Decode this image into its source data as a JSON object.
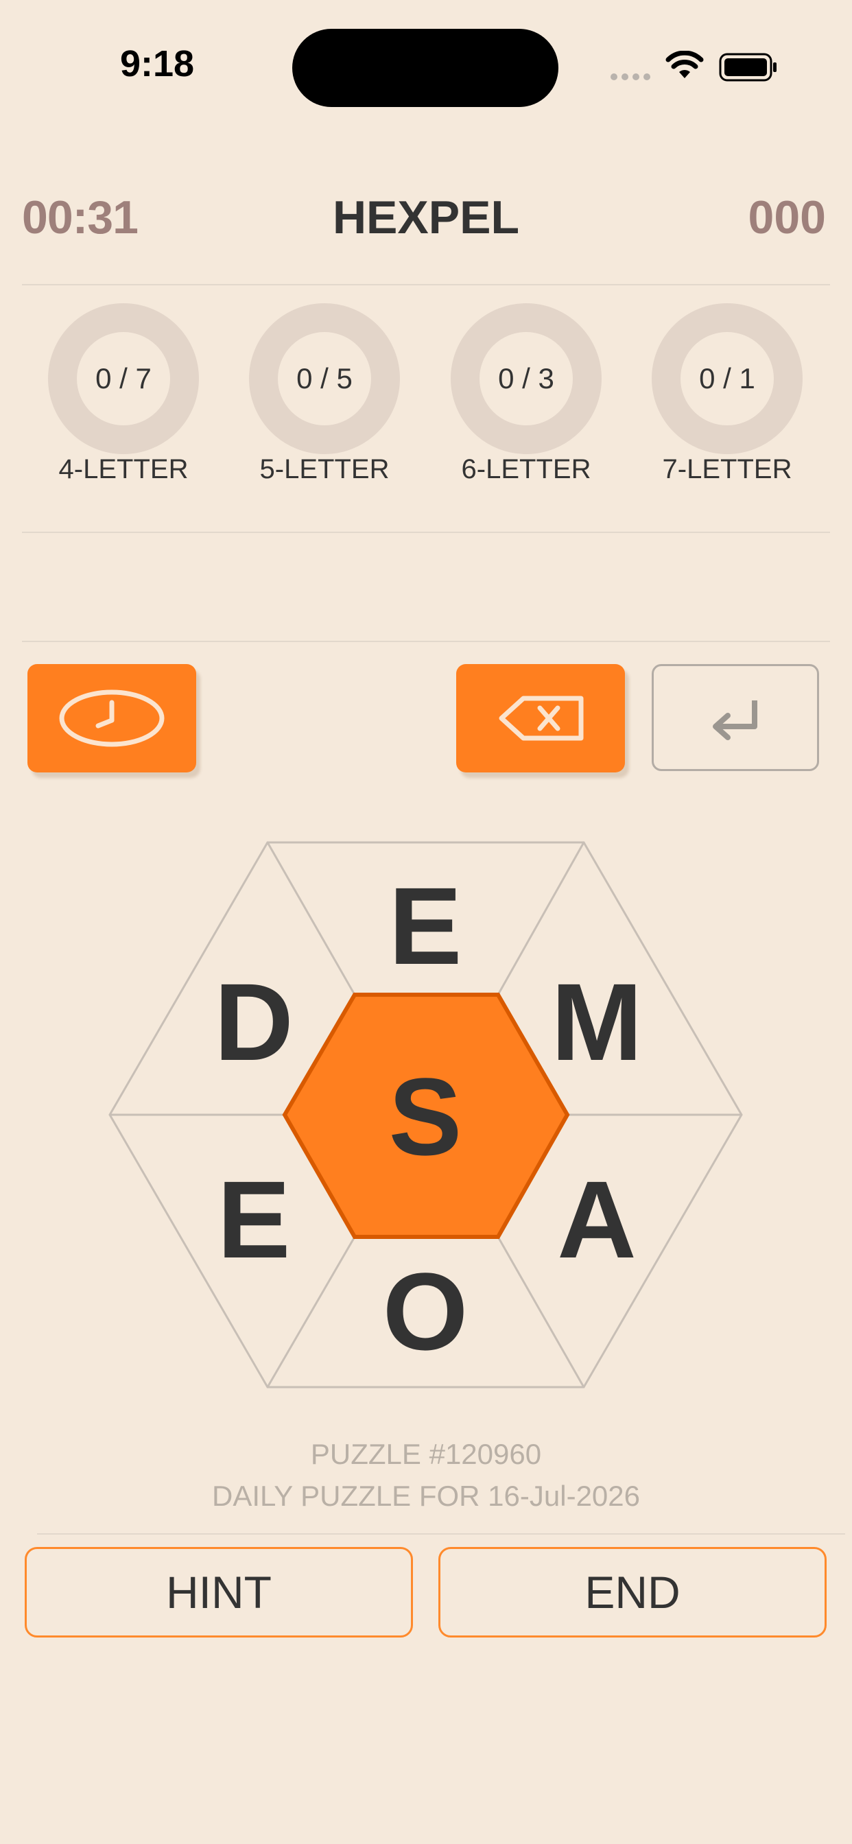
{
  "status_bar": {
    "time": "9:18",
    "icons": [
      "signal-dots-icon",
      "wifi-icon",
      "battery-icon"
    ]
  },
  "header": {
    "timer": "00:31",
    "title": "HEXPEL",
    "score": "000"
  },
  "progress": [
    {
      "count": "0 / 7",
      "label": "4-LETTER",
      "found": 0,
      "total": 7
    },
    {
      "count": "0 / 5",
      "label": "5-LETTER",
      "found": 0,
      "total": 5
    },
    {
      "count": "0 / 3",
      "label": "6-LETTER",
      "found": 0,
      "total": 3
    },
    {
      "count": "0 / 1",
      "label": "7-LETTER",
      "found": 0,
      "total": 1
    }
  ],
  "current_word": "",
  "controls": {
    "clock_icon": "clock-icon",
    "delete_icon": "backspace-icon",
    "enter_icon": "return-icon"
  },
  "board": {
    "center": "S",
    "top": "E",
    "upper_right": "M",
    "lower_right": "A",
    "bottom": "O",
    "lower_left": "E",
    "upper_left": "D"
  },
  "puzzle": {
    "number": "PUZZLE #120960",
    "daily": "DAILY PUZZLE FOR 16-Jul-2026"
  },
  "buttons": {
    "hint": "HINT",
    "end": "END"
  },
  "colors": {
    "background": "#f5e9db",
    "accent": "#ff7f1f",
    "accent_border": "#d85a00",
    "ring": "#e3d5c9",
    "muted_text": "#9e807b"
  }
}
